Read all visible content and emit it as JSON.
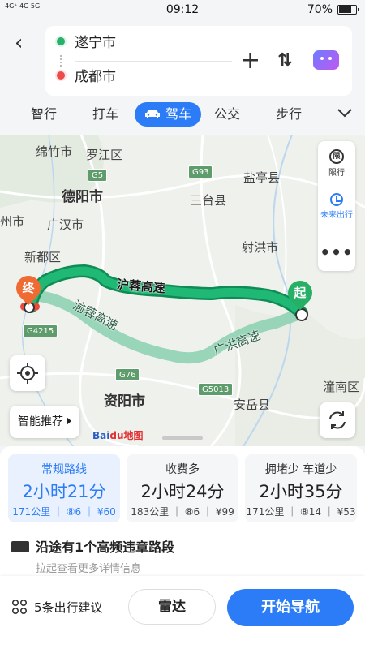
{
  "status_bar": {
    "signal_text": "4G⁺ 4G 5G",
    "time": "09:12",
    "battery": "70%",
    "battery_level": 0.7
  },
  "header": {
    "origin": "遂宁市",
    "destination": "成都市"
  },
  "modes": [
    {
      "label": "智行"
    },
    {
      "label": "打车"
    },
    {
      "label": "驾车",
      "active": true
    },
    {
      "label": "公交"
    },
    {
      "label": "步行"
    }
  ],
  "map": {
    "places": [
      {
        "label": "绵竹市"
      },
      {
        "label": "罗江区"
      },
      {
        "label": "德阳市"
      },
      {
        "label": "盐亭县"
      },
      {
        "label": "三台县"
      },
      {
        "label": "州市"
      },
      {
        "label": "广汉市"
      },
      {
        "label": "射洪市"
      },
      {
        "label": "新都区"
      },
      {
        "label": "资阳市"
      },
      {
        "label": "安岳县"
      },
      {
        "label": "潼南区"
      }
    ],
    "shields": [
      "G5",
      "G93",
      "G4215",
      "G76",
      "G5013"
    ],
    "route_main_label": "沪蓉高速",
    "route_alt_labels": [
      "渝蓉高速",
      "广洪高速"
    ],
    "end_marker": "终",
    "start_marker": "起",
    "side_panel": {
      "limit": "限行",
      "limit_icon_text": "限",
      "future": "未来出行",
      "more": "•••"
    },
    "smart_label": "智能推荐",
    "logo_bai": "Bai",
    "logo_du": "du地图"
  },
  "route_cards": [
    {
      "title": "常规路线",
      "time": "2小时21分",
      "meta": "171公里 ｜ ⑧6 ｜ ¥60",
      "selected": true
    },
    {
      "title": "收费多",
      "time": "2小时24分",
      "meta": "183公里 ｜ ⑧6 ｜ ¥99"
    },
    {
      "title": "拥堵少 车道少",
      "time": "2小时35分",
      "meta": "171公里 ｜ ⑧14 ｜ ¥53"
    }
  ],
  "warning": {
    "text": "沿途有1个高频违章路段",
    "sub": "拉起查看更多详情信息"
  },
  "bottom": {
    "suggest": "5条出行建议",
    "radar": "雷达",
    "start": "开始导航"
  },
  "colors": {
    "accent": "#2b7cf6",
    "route_main": "#1fb874",
    "route_alt": "#8fd1b3"
  }
}
